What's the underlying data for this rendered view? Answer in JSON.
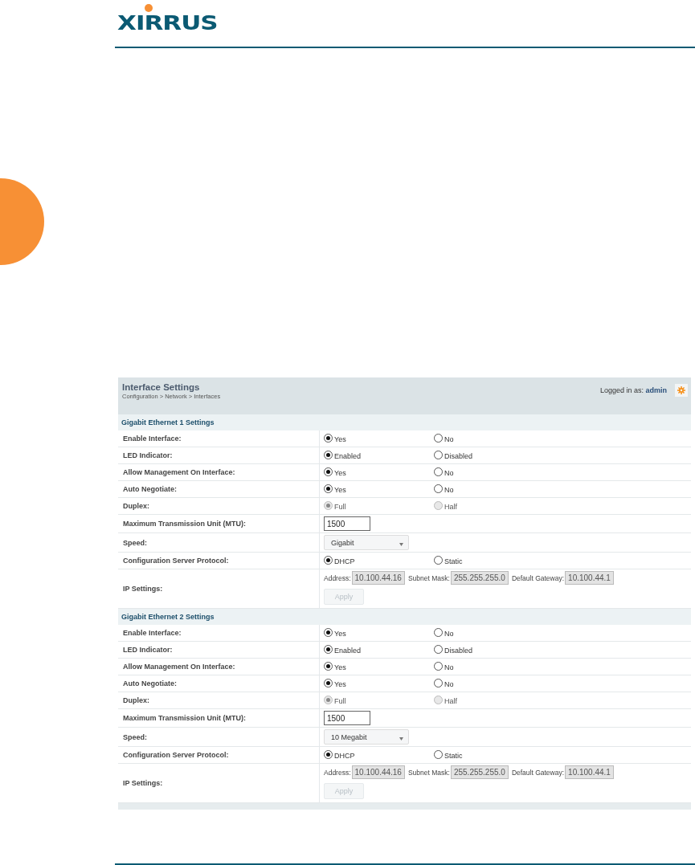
{
  "logo": "XIRRUS",
  "panel": {
    "title": "Interface Settings",
    "breadcrumb": "Configuration > Network > Interfaces",
    "login_label": "Logged in as:",
    "user": "admin"
  },
  "sections": [
    {
      "title": "Gigabit Ethernet 1 Settings",
      "rows": [
        {
          "kind": "radio",
          "label": "Enable Interface:",
          "options": [
            {
              "label": "Yes",
              "selected": true,
              "disabled": false
            },
            {
              "label": "No",
              "selected": false,
              "disabled": false
            }
          ]
        },
        {
          "kind": "radio",
          "label": "LED Indicator:",
          "options": [
            {
              "label": "Enabled",
              "selected": true,
              "disabled": false
            },
            {
              "label": "Disabled",
              "selected": false,
              "disabled": false
            }
          ]
        },
        {
          "kind": "radio",
          "label": "Allow Management On Interface:",
          "options": [
            {
              "label": "Yes",
              "selected": true,
              "disabled": false
            },
            {
              "label": "No",
              "selected": false,
              "disabled": false
            }
          ]
        },
        {
          "kind": "radio",
          "label": "Auto Negotiate:",
          "options": [
            {
              "label": "Yes",
              "selected": true,
              "disabled": false
            },
            {
              "label": "No",
              "selected": false,
              "disabled": false
            }
          ]
        },
        {
          "kind": "radio",
          "label": "Duplex:",
          "options": [
            {
              "label": "Full",
              "selected": true,
              "disabled": true
            },
            {
              "label": "Half",
              "selected": false,
              "disabled": true
            }
          ]
        },
        {
          "kind": "text",
          "label": "Maximum Transmission Unit (MTU):",
          "value": "1500"
        },
        {
          "kind": "select",
          "label": "Speed:",
          "value": "Gigabit"
        },
        {
          "kind": "radio",
          "label": "Configuration Server Protocol:",
          "options": [
            {
              "label": "DHCP",
              "selected": true,
              "disabled": false
            },
            {
              "label": "Static",
              "selected": false,
              "disabled": false
            }
          ]
        },
        {
          "kind": "ip",
          "label": "IP Settings:",
          "fields": [
            {
              "label": "Address:",
              "value": "10.100.44.16"
            },
            {
              "label": "Subnet Mask:",
              "value": "255.255.255.0"
            },
            {
              "label": "Default Gateway:",
              "value": "10.100.44.1"
            }
          ],
          "button": {
            "label": "Apply",
            "disabled": true
          }
        }
      ]
    },
    {
      "title": "Gigabit Ethernet 2 Settings",
      "rows": [
        {
          "kind": "radio",
          "label": "Enable Interface:",
          "options": [
            {
              "label": "Yes",
              "selected": true,
              "disabled": false
            },
            {
              "label": "No",
              "selected": false,
              "disabled": false
            }
          ]
        },
        {
          "kind": "radio",
          "label": "LED Indicator:",
          "options": [
            {
              "label": "Enabled",
              "selected": true,
              "disabled": false
            },
            {
              "label": "Disabled",
              "selected": false,
              "disabled": false
            }
          ]
        },
        {
          "kind": "radio",
          "label": "Allow Management On Interface:",
          "options": [
            {
              "label": "Yes",
              "selected": true,
              "disabled": false
            },
            {
              "label": "No",
              "selected": false,
              "disabled": false
            }
          ]
        },
        {
          "kind": "radio",
          "label": "Auto Negotiate:",
          "options": [
            {
              "label": "Yes",
              "selected": true,
              "disabled": false
            },
            {
              "label": "No",
              "selected": false,
              "disabled": false
            }
          ]
        },
        {
          "kind": "radio",
          "label": "Duplex:",
          "options": [
            {
              "label": "Full",
              "selected": true,
              "disabled": true
            },
            {
              "label": "Half",
              "selected": false,
              "disabled": true
            }
          ]
        },
        {
          "kind": "text",
          "label": "Maximum Transmission Unit (MTU):",
          "value": "1500"
        },
        {
          "kind": "select",
          "label": "Speed:",
          "value": "10 Megabit"
        },
        {
          "kind": "radio",
          "label": "Configuration Server Protocol:",
          "options": [
            {
              "label": "DHCP",
              "selected": true,
              "disabled": false
            },
            {
              "label": "Static",
              "selected": false,
              "disabled": false
            }
          ]
        },
        {
          "kind": "ip",
          "label": "IP Settings:",
          "fields": [
            {
              "label": "Address:",
              "value": "10.100.44.16"
            },
            {
              "label": "Subnet Mask:",
              "value": "255.255.255.0"
            },
            {
              "label": "Default Gateway:",
              "value": "10.100.44.1"
            }
          ],
          "button": {
            "label": "Apply",
            "disabled": true
          }
        }
      ]
    }
  ]
}
